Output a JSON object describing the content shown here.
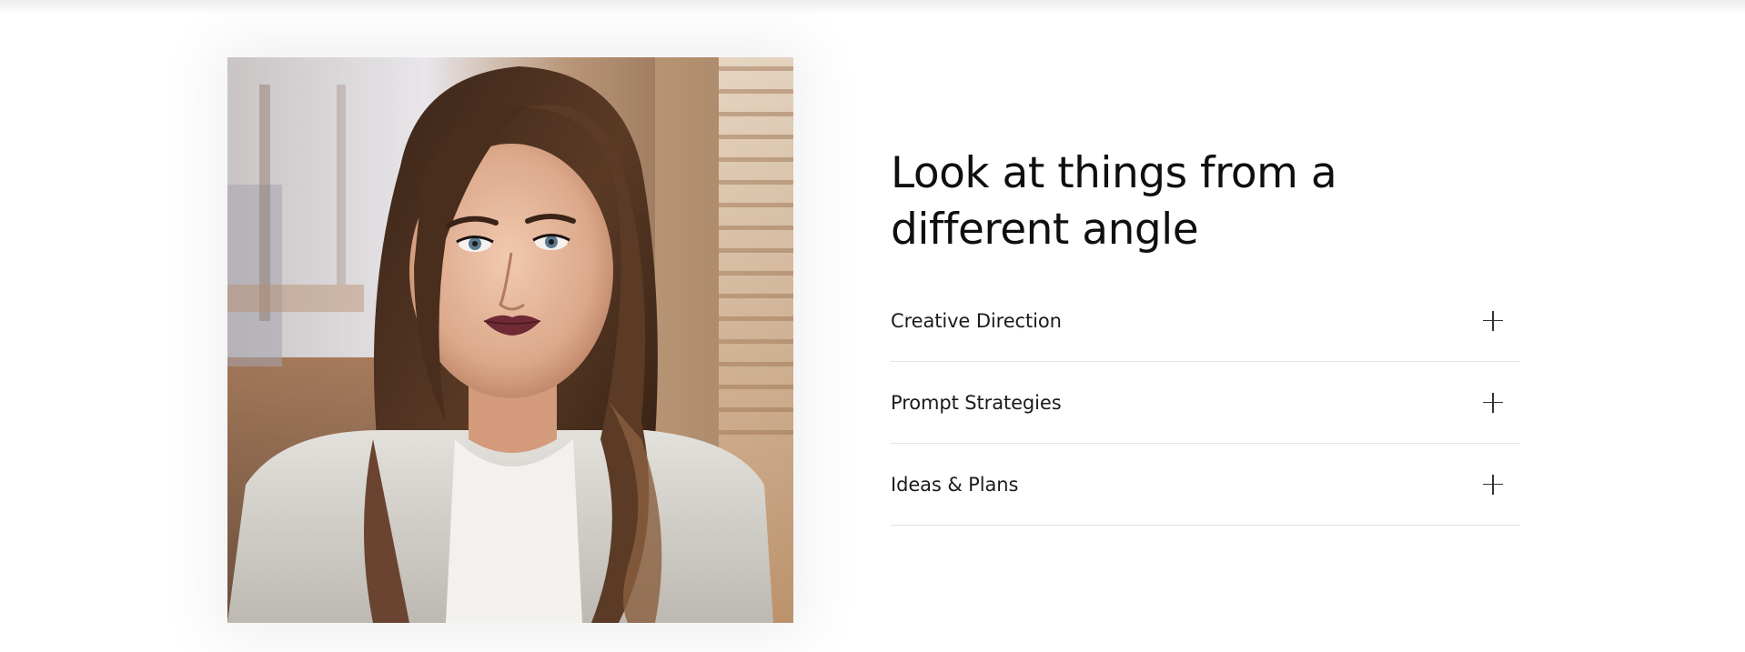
{
  "section": {
    "heading": "Look at things from a different angle",
    "photo_alt": "Portrait of a woman with long wavy brown hair",
    "accordion": [
      {
        "label": "Creative Direction",
        "icon": "plus-icon"
      },
      {
        "label": "Prompt Strategies",
        "icon": "plus-icon"
      },
      {
        "label": "Ideas & Plans",
        "icon": "plus-icon"
      }
    ]
  },
  "colors": {
    "heading": "#0f0f0f",
    "divider": "#e4e4e4",
    "background": "#ffffff"
  }
}
